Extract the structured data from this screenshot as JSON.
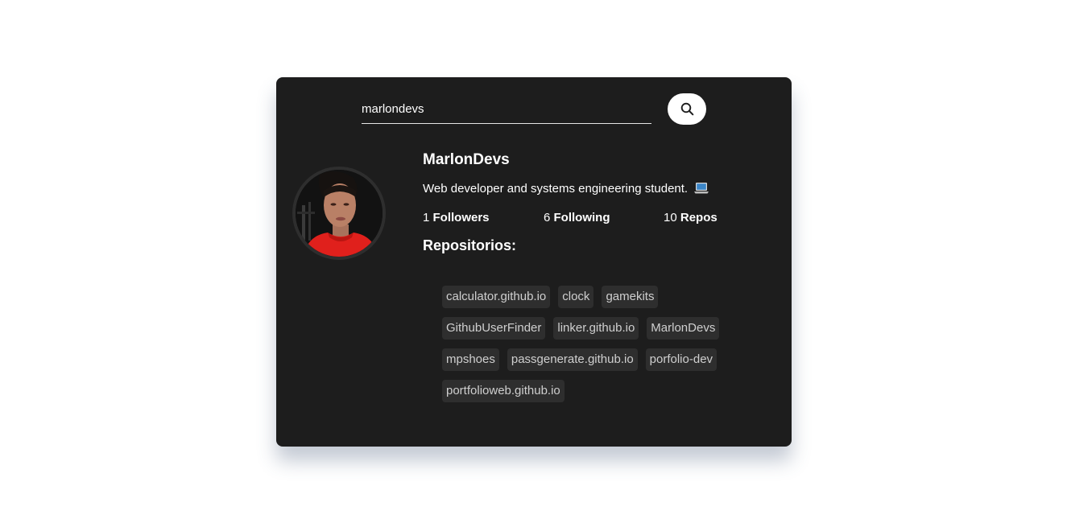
{
  "search": {
    "value": "marlondevs"
  },
  "profile": {
    "name": "MarlonDevs",
    "bio": "Web developer and systems engineering student.",
    "followers_count": "1",
    "followers_label": "Followers",
    "following_count": "6",
    "following_label": "Following",
    "repos_count": "10",
    "repos_label": "Repos"
  },
  "repositories": {
    "title": "Repositorios:",
    "items": [
      "calculator.github.io",
      "clock",
      "gamekits",
      "GithubUserFinder",
      "linker.github.io",
      "MarlonDevs",
      "mpshoes",
      "passgenerate.github.io",
      "porfolio-dev",
      "portfolioweb.github.io"
    ]
  },
  "icons": {
    "search": "search-icon",
    "bio_emoji": "laptop-icon"
  },
  "colors": {
    "card_background": "#1d1d1d",
    "tag_background": "#2e2e2e",
    "text": "#ffffff",
    "tag_text": "#cfcfcf"
  }
}
